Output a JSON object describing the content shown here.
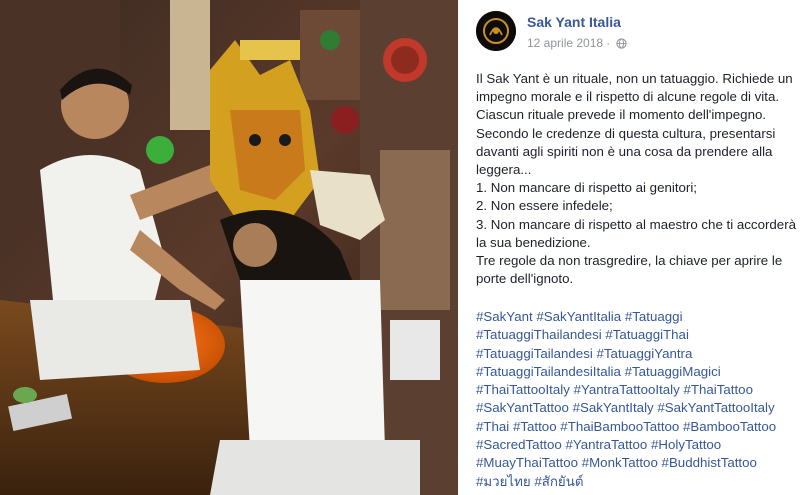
{
  "post": {
    "page_name": "Sak Yant Italia",
    "date": "12 aprile 2018",
    "separator": "·",
    "privacy_icon": "globe-icon",
    "avatar_icon": "sak-yant-logo",
    "photo_icon": "ritual-photo",
    "paragraphs": [
      "Il Sak Yant è un rituale, non un tatuaggio. Richiede un impegno morale e il rispetto di alcune regole di vita. Ciascun rituale prevede il momento dell'impegno. Secondo le credenze di questa cultura, presentarsi davanti agli spiriti non è una cosa da prendere alla leggera...",
      "1. Non mancare di rispetto ai genitori;",
      "2. Non essere infedele;",
      "3. Non mancare di rispetto al maestro che ti accorderà la sua benedizione.",
      "Tre regole da non trasgredire, la chiave per aprire le porte dell'ignoto."
    ],
    "hashtags": [
      "#SakYant",
      "#SakYantItalia",
      "#Tatuaggi",
      "#TatuaggiThailandesi",
      "#TatuaggiThai",
      "#TatuaggiTailandesi",
      "#TatuaggiYantra",
      "#TatuaggiTailandesiItalia",
      "#TatuaggiMagici",
      "#ThaiTattooItaly",
      "#YantraTattooItaly",
      "#ThaiTattoo",
      "#SakYantTattoo",
      "#SakYantItaly",
      "#SakYantTattooItaly",
      "#Thai",
      "#Tattoo",
      "#ThaiBambooTattoo",
      "#BambooTattoo",
      "#SacredTattoo",
      "#YantraTattoo",
      "#HolyTattoo",
      "#MuayThaiTattoo",
      "#MonkTattoo",
      "#BuddhistTattoo",
      "#มวยไทย",
      "#สักยันต์"
    ]
  },
  "colors": {
    "link": "#365899",
    "page_name": "#385898",
    "text": "#1d2129",
    "meta": "#90949c"
  }
}
